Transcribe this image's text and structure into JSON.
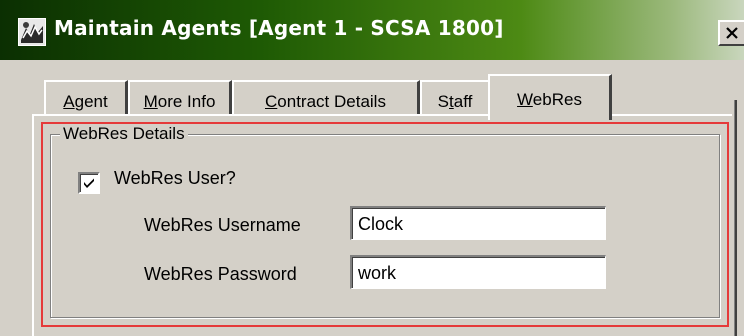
{
  "window": {
    "title": "Maintain Agents [Agent 1 - SCSA 1800]",
    "close_glyph": "×",
    "icon": "app-icon",
    "titlebar_color_start": "#0b2f02",
    "titlebar_color_end": "#c9d6bd"
  },
  "tabs": [
    {
      "label": "Agent",
      "mnemonic": "A",
      "rest": "gent",
      "active": false
    },
    {
      "label": "More Info",
      "mnemonic": "M",
      "rest": "ore Info",
      "active": false
    },
    {
      "label": "Contract Details",
      "mnemonic": "C",
      "rest": "ontract Details",
      "active": false
    },
    {
      "label": "Staff",
      "pre": "S",
      "mnemonic": "t",
      "rest": "aff",
      "active": false
    },
    {
      "label": "WebRes",
      "mnemonic": "W",
      "rest": "ebRes",
      "active": true
    }
  ],
  "group": {
    "title": "WebRes Details",
    "highlight_color": "#e53a3a",
    "checkbox": {
      "label": "WebRes User?",
      "checked": true
    },
    "fields": [
      {
        "label": "WebRes Username",
        "value": "Clock"
      },
      {
        "label": "WebRes Password",
        "value": "work"
      }
    ]
  }
}
